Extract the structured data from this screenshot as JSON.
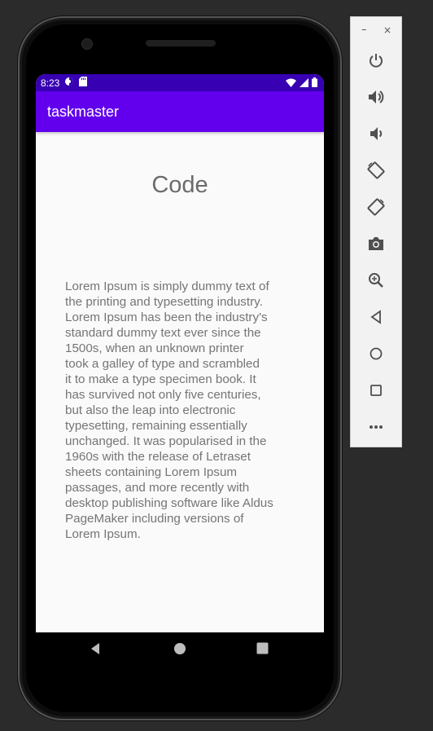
{
  "status_bar": {
    "time": "8:23",
    "background": "#3700b3"
  },
  "app_bar": {
    "title": "taskmaster",
    "background": "#6200ee"
  },
  "content": {
    "heading": "Code",
    "body_lines": [
      "Lorem Ipsum is simply dummy text of",
      "the printing and typesetting industry.",
      "Lorem Ipsum has been the industry's",
      "standard dummy text ever since the",
      "1500s, when an unknown printer",
      "took a galley of type and scrambled",
      "it to make a type specimen book. It",
      "has survived not only five centuries,",
      "but also the leap into electronic",
      "typesetting, remaining essentially",
      "unchanged. It was popularised in the",
      "1960s with the release of Letraset",
      "sheets containing Lorem Ipsum",
      "passages, and more recently with",
      "desktop publishing software like Aldus",
      "PageMaker including versions of",
      "Lorem Ipsum."
    ]
  },
  "nav_bar": {
    "buttons": [
      "back-icon",
      "home-icon",
      "overview-icon"
    ]
  },
  "emulator_panel": {
    "window_controls": {
      "minimize": "–",
      "close": "×"
    },
    "buttons": [
      "power-icon",
      "volume-up-icon",
      "volume-down-icon",
      "rotate-left-icon",
      "rotate-right-icon",
      "camera-icon",
      "zoom-icon",
      "back-icon",
      "home-icon",
      "overview-icon",
      "more-icon"
    ]
  }
}
